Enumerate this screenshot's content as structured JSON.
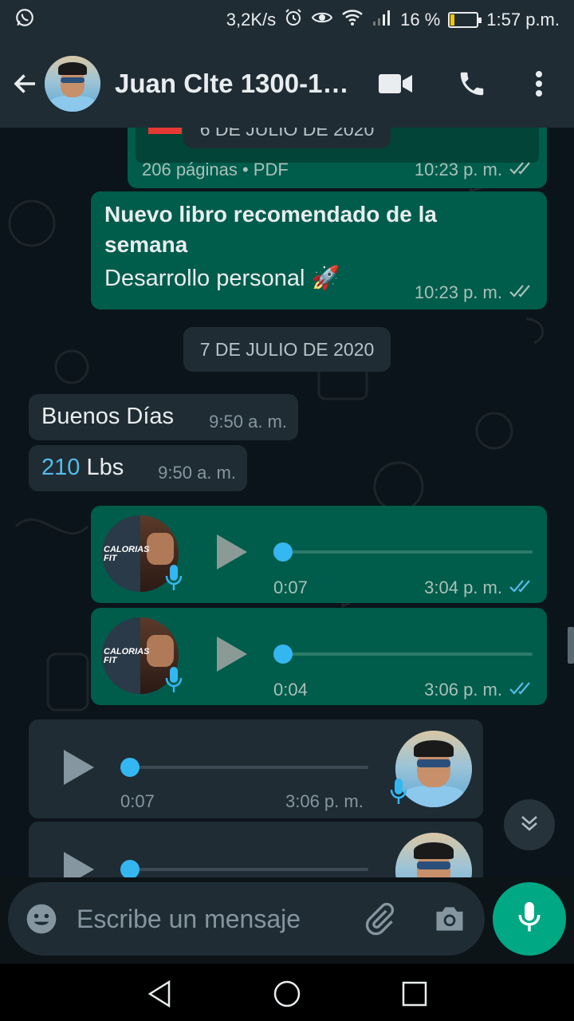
{
  "status_bar": {
    "speed": "3,2K/s",
    "battery_percent": "16 %",
    "battery_level": 0.16,
    "time": "1:57 p.m.",
    "icons": [
      "whatsapp-icon",
      "alarm-icon",
      "eye-icon",
      "wifi-icon",
      "signal-icon",
      "battery-icon"
    ]
  },
  "header": {
    "contact_name": "Juan Clte 1300-1…",
    "actions": [
      "back-arrow-icon",
      "video-call-icon",
      "phone-icon",
      "more-vert-icon"
    ]
  },
  "chat": {
    "partial_date_chip": "6 DE JULIO DE 2020",
    "pdf_message": {
      "info": "206 páginas • PDF",
      "time": "10:23 p. m."
    },
    "text_message": {
      "title": "Nuevo libro recomendado de la semana",
      "body": "Desarrollo personal 🚀",
      "time": "10:23 p. m."
    },
    "date_chip": "7 DE JULIO DE 2020",
    "incoming_1": {
      "text": "Buenos Días",
      "time": "9:50 a. m."
    },
    "incoming_2": {
      "number": "210",
      "unit": " Lbs",
      "time": "9:50 a. m."
    },
    "voice_out_1": {
      "duration": "0:07",
      "time": "3:04 p. m.",
      "thumb_label": "CALORIAS FIT"
    },
    "voice_out_2": {
      "duration": "0:04",
      "time": "3:06 p. m.",
      "thumb_label": "CALORIAS FIT"
    },
    "voice_in_1": {
      "duration": "0:07",
      "time": "3:06 p. m."
    }
  },
  "composer": {
    "placeholder": "Escribe un mensaje"
  },
  "colors": {
    "header_bg": "#1f2c34",
    "outgoing_bubble": "#005c4b",
    "incoming_bubble": "#1f2c34",
    "read_ticks": "#53bdeb",
    "accent": "#00a884"
  }
}
